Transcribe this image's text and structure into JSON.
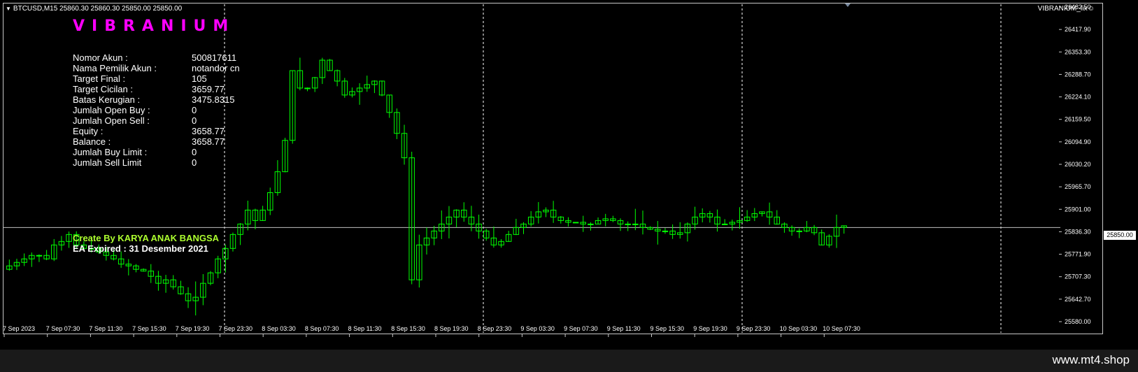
{
  "chart_header": {
    "symbol_line": "BTCUSD,M15  25860.30 25860.30 25850.00 25850.00"
  },
  "logo_text": "VIBRANIUM",
  "expert_name": "VIBRANIUM_fix",
  "expert_icon": "smiley-icon",
  "account_info": [
    {
      "label": "Nomor Akun :",
      "value": "500817611"
    },
    {
      "label": "Nama Pemilik Akun :",
      "value": "notandor cn"
    },
    {
      "label": "Target Final :",
      "value": "105"
    },
    {
      "label": "Target Cicilan :",
      "value": "3659.77"
    },
    {
      "label": "Batas Kerugian :",
      "value": "3475.8315"
    },
    {
      "label": "Jumlah Open Buy :",
      "value": "0"
    },
    {
      "label": "Jumlah Open Sell :",
      "value": "0"
    },
    {
      "label": "Equity :",
      "value": "3658.77"
    },
    {
      "label": "Balance :",
      "value": "3658.77"
    },
    {
      "label": "Jumlah Buy Limit :",
      "value": "0"
    },
    {
      "label": "Jumlah Sell Limit",
      "value": "0"
    }
  ],
  "credit_text": "Create By KARYA ANAK BANGSA",
  "expiry_text": "EA Expired : 31 Desember 2021",
  "current_price_tag": "25850.00",
  "watermark": "www.mt4.shop",
  "colors": {
    "background": "#000000",
    "candles": "#00ff00",
    "grid_separator": "#ffffff",
    "logo": "#ff00ff",
    "credit": "#adff2f",
    "bid_line": "#c0c0c0"
  },
  "chart_data": {
    "type": "candlestick",
    "symbol": "BTCUSD",
    "timeframe": "M15",
    "current_price": 25850.0,
    "ylim": [
      25580.0,
      26482.5
    ],
    "y_ticks": [
      "26482.50",
      "26417.90",
      "26353.30",
      "26288.70",
      "26224.10",
      "26159.50",
      "26094.90",
      "26030.20",
      "25965.70",
      "25901.00",
      "25836.30",
      "25771.90",
      "25707.30",
      "25642.70",
      "25580.00"
    ],
    "x_ticks": [
      "7 Sep 2023",
      "7 Sep 07:30",
      "7 Sep 11:30",
      "7 Sep 15:30",
      "7 Sep 19:30",
      "7 Sep 23:30",
      "8 Sep 03:30",
      "8 Sep 07:30",
      "8 Sep 11:30",
      "8 Sep 15:30",
      "8 Sep 19:30",
      "8 Sep 23:30",
      "9 Sep 03:30",
      "9 Sep 07:30",
      "9 Sep 11:30",
      "9 Sep 15:30",
      "9 Sep 19:30",
      "9 Sep 23:30",
      "10 Sep 03:30",
      "10 Sep 07:30"
    ],
    "closes": [
      25740,
      25750,
      25760,
      25770,
      25770,
      25760,
      25800,
      25810,
      25830,
      25800,
      25790,
      25790,
      25780,
      25770,
      25760,
      25745,
      25740,
      25730,
      25725,
      25710,
      25690,
      25700,
      25680,
      25660,
      25640,
      25650,
      25690,
      25720,
      25760,
      25790,
      25830,
      25860,
      25900,
      25870,
      25900,
      25950,
      26010,
      26100,
      26300,
      26250,
      26250,
      26280,
      26330,
      26300,
      26270,
      26230,
      26240,
      26250,
      26260,
      26270,
      26230,
      26180,
      26120,
      26050,
      25700,
      25800,
      25820,
      25840,
      25860,
      25880,
      25900,
      25880,
      25860,
      25840,
      25820,
      25800,
      25810,
      25830,
      25850,
      25860,
      25880,
      25895,
      25900,
      25880,
      25870,
      25865,
      25865,
      25860,
      25860,
      25870,
      25875,
      25870,
      25860,
      25860,
      25860,
      25850,
      25845,
      25840,
      25840,
      25830,
      25835,
      25860,
      25880,
      25890,
      25880,
      25860,
      25860,
      25865,
      25870,
      25880,
      25890,
      25895,
      25880,
      25860,
      25850,
      25840,
      25840,
      25850,
      25835,
      25800,
      25825,
      25850,
      25855
    ]
  }
}
